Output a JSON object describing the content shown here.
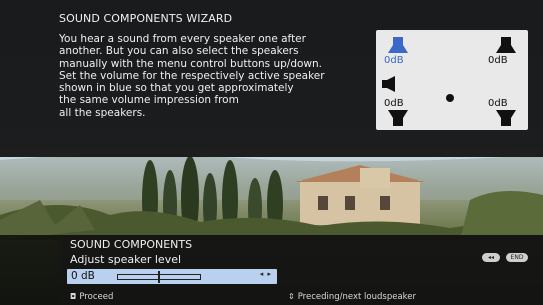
{
  "wizard": {
    "title": "SOUND COMPONENTS WIZARD",
    "body_lines": [
      "You hear a sound from every speaker one after",
      "another. But you can also select the speakers",
      "manually with the menu control buttons up/down.",
      "Set the volume for the respectively active speaker",
      "shown in blue so that you get approximately",
      "the same volume impression from",
      "all the speakers."
    ]
  },
  "speakers": {
    "front_left": {
      "level": "0dB",
      "active": true
    },
    "front_right": {
      "level": "0dB",
      "active": false
    },
    "center_left": {
      "level": "",
      "active": false
    },
    "rear_left": {
      "level": "0dB",
      "active": false
    },
    "rear_right": {
      "level": "0dB",
      "active": false
    },
    "active_color": "#3b67c9",
    "inactive_color": "#111111"
  },
  "panel": {
    "title": "SOUND COMPONENTS",
    "subtitle": "Adjust speaker level",
    "level_value": "0 dB",
    "level_fraction": 0.5,
    "arrows": "◂ ▸",
    "back_pill": "◂◂",
    "end_pill": "END",
    "hint_proceed_icon": "ok-icon",
    "hint_proceed": "Proceed",
    "hint_nav_icon": "up-down-icon",
    "hint_nav": "Preceding/next loudspeaker"
  }
}
